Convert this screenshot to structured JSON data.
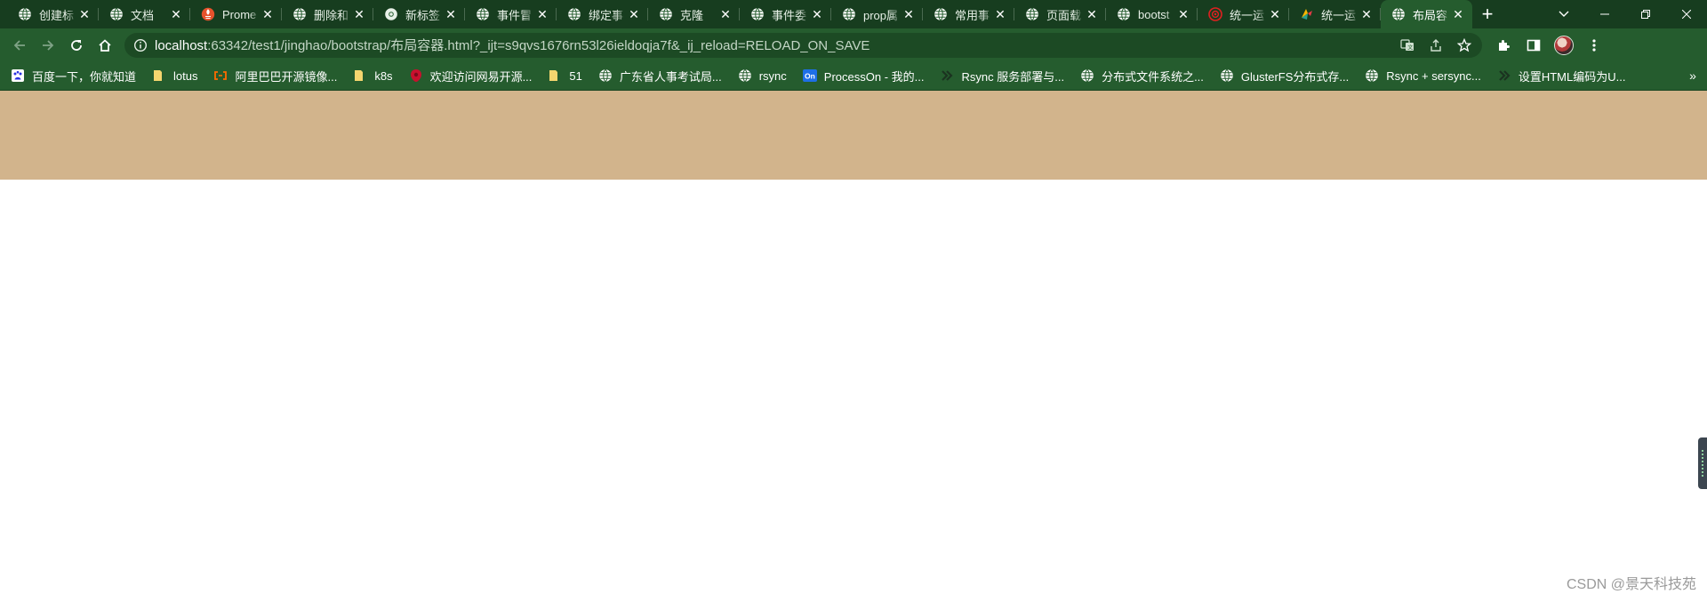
{
  "tabs": [
    {
      "title": "创建标",
      "icon": "globe-icon",
      "active": false
    },
    {
      "title": "文档",
      "icon": "globe-icon",
      "active": false
    },
    {
      "title": "Prome",
      "icon": "prometheus-icon",
      "active": false
    },
    {
      "title": "删除和",
      "icon": "globe-icon",
      "active": false
    },
    {
      "title": "新标签",
      "icon": "chrome-icon",
      "active": false
    },
    {
      "title": "事件冒",
      "icon": "globe-icon",
      "active": false
    },
    {
      "title": "绑定事",
      "icon": "globe-icon",
      "active": false
    },
    {
      "title": "克隆",
      "icon": "globe-icon",
      "active": false
    },
    {
      "title": "事件委",
      "icon": "globe-icon",
      "active": false
    },
    {
      "title": "prop属",
      "icon": "globe-icon",
      "active": false
    },
    {
      "title": "常用事",
      "icon": "globe-icon",
      "active": false
    },
    {
      "title": "页面载",
      "icon": "globe-icon",
      "active": false
    },
    {
      "title": "bootst",
      "icon": "globe-icon",
      "active": false
    },
    {
      "title": "统一运",
      "icon": "weibo-icon",
      "active": false
    },
    {
      "title": "统一运",
      "icon": "colorful-app-icon",
      "active": false
    },
    {
      "title": "布局容",
      "icon": "globe-icon",
      "active": true
    }
  ],
  "tab_close_glyph": "✕",
  "new_tab_glyph": "+",
  "address": {
    "host": "localhost",
    "path": ":63342/test1/jinghao/bootstrap/布局容器.html?_ijt=s9qvs1676rn53l26ieldoqja7f&_ij_reload=RELOAD_ON_SAVE"
  },
  "bookmarks": [
    {
      "label": "百度一下，你就知道",
      "icon": "baidu-icon"
    },
    {
      "label": "lotus",
      "icon": "folder-icon"
    },
    {
      "label": "阿里巴巴开源镜像...",
      "icon": "aliyun-icon"
    },
    {
      "label": "k8s",
      "icon": "folder-icon"
    },
    {
      "label": "欢迎访问网易开源...",
      "icon": "netease-icon"
    },
    {
      "label": "51",
      "icon": "folder-icon"
    },
    {
      "label": "广东省人事考试局...",
      "icon": "globe-icon"
    },
    {
      "label": "rsync",
      "icon": "globe-icon"
    },
    {
      "label": "ProcessOn - 我的...",
      "icon": "processon-icon"
    },
    {
      "label": "Rsync 服务部署与...",
      "icon": "dark-app-icon"
    },
    {
      "label": "分布式文件系统之...",
      "icon": "globe-icon"
    },
    {
      "label": "GlusterFS分布式存...",
      "icon": "globe-icon"
    },
    {
      "label": "Rsync + sersync...",
      "icon": "globe-icon"
    },
    {
      "label": "设置HTML编码为U...",
      "icon": "dark-app-icon"
    }
  ],
  "bookmarks_more_glyph": "»",
  "processon_badge": "On",
  "watermark": "CSDN @景天科技苑",
  "colors": {
    "tabstrip": "#173d1f",
    "toolbar": "#255c2e",
    "container_box": "#d2b48c"
  }
}
